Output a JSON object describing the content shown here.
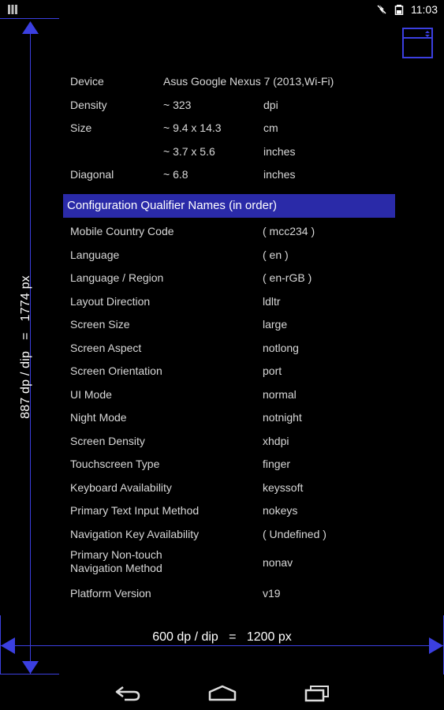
{
  "status_bar": {
    "time": "11:03",
    "left_icon": "grid-icon",
    "icons": [
      "no-data-icon",
      "battery-icon"
    ]
  },
  "measurements": {
    "vertical_label": "887 dp / dip   =   1774 px",
    "horizontal_label": "600 dp / dip   =   1200 px"
  },
  "device_info": {
    "rows": [
      {
        "label": "Device",
        "value": "Asus Google Nexus 7 (2013,Wi-Fi)",
        "unit": ""
      },
      {
        "label": "Density",
        "value": "~ 323",
        "unit": "dpi"
      },
      {
        "label": "Size",
        "value": "~ 9.4 x 14.3",
        "unit": "cm"
      },
      {
        "label": "",
        "value": "~ 3.7 x 5.6",
        "unit": "inches"
      },
      {
        "label": "Diagonal",
        "value": "~ 6.8",
        "unit": "inches"
      }
    ]
  },
  "section_header": "Configuration Qualifier Names (in order)",
  "qualifiers": [
    {
      "name": "Mobile Country Code",
      "value": "( mcc234 )"
    },
    {
      "name": "Language",
      "value": "( en )"
    },
    {
      "name": "Language / Region",
      "value": "( en-rGB )"
    },
    {
      "name": "Layout Direction",
      "value": "ldltr"
    },
    {
      "name": "Screen Size",
      "value": "large"
    },
    {
      "name": "Screen Aspect",
      "value": "notlong"
    },
    {
      "name": "Screen Orientation",
      "value": "port"
    },
    {
      "name": "UI Mode",
      "value": "normal"
    },
    {
      "name": "Night Mode",
      "value": "notnight"
    },
    {
      "name": "Screen Density",
      "value": "xhdpi"
    },
    {
      "name": "Touchscreen Type",
      "value": "finger"
    },
    {
      "name": "Keyboard Availability",
      "value": "keyssoft"
    },
    {
      "name": "Primary Text Input Method",
      "value": "nokeys"
    },
    {
      "name": "Navigation Key Availability",
      "value": "( Undefined )"
    },
    {
      "name": "Primary Non-touch\nNavigation Method",
      "value": "nonav"
    },
    {
      "name": "Platform Version",
      "value": "v19"
    }
  ],
  "navigation": {
    "back": "back-icon",
    "home": "home-icon",
    "recents": "recents-icon"
  },
  "colors": {
    "accent": "#3b3fe0",
    "header_bg": "#2a2aa8"
  }
}
